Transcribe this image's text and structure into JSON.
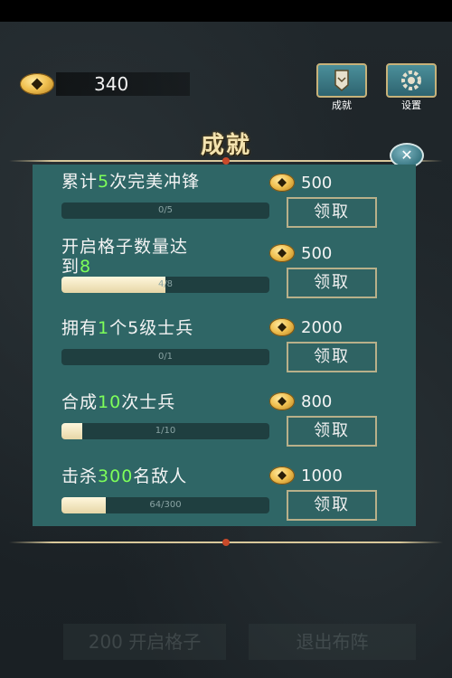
{
  "header": {
    "gold": "340",
    "achievements_label": "成就",
    "settings_label": "设置"
  },
  "dialog": {
    "title": "成就",
    "close_label": "✕"
  },
  "achievements": [
    {
      "pre": "累计",
      "num": "5",
      "post": "次完美冲锋",
      "line2": "",
      "progress_text": "0/5",
      "progress": 0.0,
      "reward": "500",
      "button": "领取"
    },
    {
      "pre": "开启格子数量达",
      "num": "",
      "post": "",
      "line2_pre": "到",
      "line2_num": "8",
      "progress_text": "4/8",
      "progress": 0.5,
      "reward": "500",
      "button": "领取"
    },
    {
      "pre": "拥有",
      "num": "1",
      "post": "个5级士兵",
      "line2": "",
      "progress_text": "0/1",
      "progress": 0.0,
      "reward": "2000",
      "button": "领取"
    },
    {
      "pre": "合成",
      "num": "10",
      "post": "次士兵",
      "line2": "",
      "progress_text": "1/10",
      "progress": 0.1,
      "reward": "800",
      "button": "领取"
    },
    {
      "pre": "击杀",
      "num": "300",
      "post": "名敌人",
      "line2": "",
      "progress_text": "64/300",
      "progress": 0.213,
      "reward": "1000",
      "button": "领取"
    }
  ],
  "background": {
    "bottom_left_value": "200",
    "bottom_left_label": "开启格子",
    "bottom_right_label": "退出布阵"
  },
  "colors": {
    "panel": "#2f6666",
    "highlight": "#7dff5a",
    "title": "#f3e3b0"
  }
}
